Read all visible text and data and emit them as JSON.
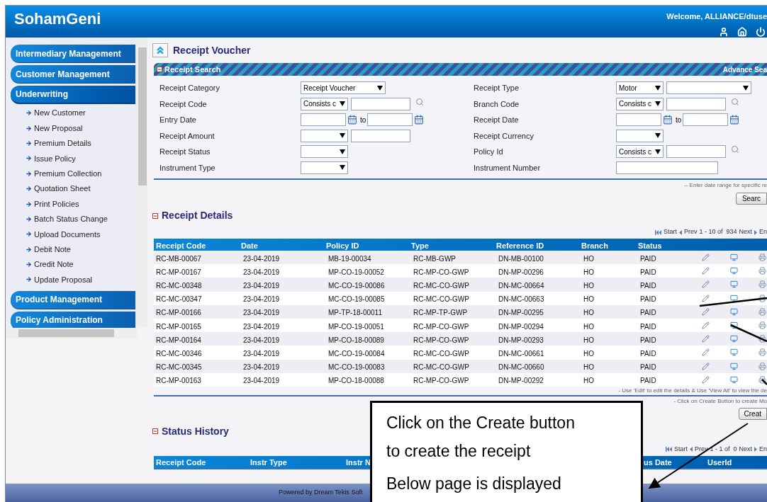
{
  "header": {
    "app_title": "SohamGeni",
    "welcome": "Welcome, ALLIANCE/dtuse"
  },
  "sidebar": {
    "sections": [
      {
        "label": "Intermediary Management",
        "expanded": false
      },
      {
        "label": "Customer Management",
        "expanded": false
      },
      {
        "label": "Underwriting",
        "expanded": true,
        "items": [
          "New Customer",
          "New Proposal",
          "Premium Details",
          "Issue Policy",
          "Premium Collection",
          "Quotation Sheet",
          "Print Policies",
          "Batch Status Change",
          "Upload Documents",
          "Debit Note",
          "Credit Note",
          "Update Proposal"
        ]
      },
      {
        "label": "Product Management",
        "expanded": false
      },
      {
        "label": "Policy Administration",
        "expanded": false
      }
    ]
  },
  "page_title": "Receipt Voucher",
  "search": {
    "title": "Receipt Search",
    "advance_link": "Advance Sea",
    "left_fields": [
      {
        "label": "Receipt Category",
        "kind": "select_wide",
        "value": "Receipt Voucher"
      },
      {
        "label": "Receipt Code",
        "kind": "op_lookup",
        "value": "Consists c"
      },
      {
        "label": "Entry Date",
        "kind": "date_range",
        "separator": "to"
      },
      {
        "label": "Receipt Amount",
        "kind": "select_input"
      },
      {
        "label": "Receipt Status",
        "kind": "select"
      },
      {
        "label": "Instrument Type",
        "kind": "select"
      }
    ],
    "right_fields": [
      {
        "label": "Receipt Type",
        "kind": "select_pair",
        "value": "Motor"
      },
      {
        "label": "Branch Code",
        "kind": "op_lookup",
        "value": "Consists c"
      },
      {
        "label": "Receipt Date",
        "kind": "date_range",
        "separator": "to"
      },
      {
        "label": "Receipt Currency",
        "kind": "select"
      },
      {
        "label": "Policy Id",
        "kind": "op_lookup",
        "value": "Consists c"
      },
      {
        "label": "Instrument Number",
        "kind": "input"
      }
    ],
    "hint": "-- Enter date range for specific re",
    "search_button": "Searc"
  },
  "receipt_details": {
    "title": "Receipt Details",
    "pager": {
      "start": "Start",
      "prev": "Prev",
      "range": "1 - 10 of  934",
      "next": "Next",
      "end": "En"
    },
    "columns": [
      "Receipt Code",
      "Date",
      "Policy ID",
      "Type",
      "Reference ID",
      "Branch",
      "Status"
    ],
    "rows": [
      [
        "RC-MB-00067",
        "23-04-2019",
        "MB-19-00034",
        "RC-MB-GWP",
        "DN-MB-00100",
        "HO",
        "PAID"
      ],
      [
        "RC-MP-00167",
        "23-04-2019",
        "MP-CO-19-00052",
        "RC-MP-CO-GWP",
        "DN-MP-00296",
        "HO",
        "PAID"
      ],
      [
        "RC-MC-00348",
        "23-04-2019",
        "MC-CO-19-00086",
        "RC-MC-CO-GWP",
        "DN-MC-00664",
        "HO",
        "PAID"
      ],
      [
        "RC-MC-00347",
        "23-04-2019",
        "MC-CO-19-00085",
        "RC-MC-CO-GWP",
        "DN-MC-00663",
        "HO",
        "PAID"
      ],
      [
        "RC-MP-00166",
        "23-04-2019",
        "MP-TP-18-00011",
        "RC-MP-TP-GWP",
        "DN-MP-00295",
        "HO",
        "PAID"
      ],
      [
        "RC-MP-00165",
        "23-04-2019",
        "MP-CO-19-00051",
        "RC-MP-CO-GWP",
        "DN-MP-00294",
        "HO",
        "PAID"
      ],
      [
        "RC-MP-00164",
        "23-04-2019",
        "MP-CO-18-00089",
        "RC-MP-CO-GWP",
        "DN-MP-00293",
        "HO",
        "PAID"
      ],
      [
        "RC-MC-00346",
        "23-04-2019",
        "MC-CO-19-00084",
        "RC-MC-CO-GWP",
        "DN-MC-00661",
        "HO",
        "PAID"
      ],
      [
        "RC-MC-00345",
        "23-04-2019",
        "MC-CO-19-00083",
        "RC-MC-CO-GWP",
        "DN-MC-00660",
        "HO",
        "PAID"
      ],
      [
        "RC-MP-00163",
        "23-04-2019",
        "MP-CO-18-00088",
        "RC-MP-CO-GWP",
        "DN-MP-00292",
        "HO",
        "PAID"
      ]
    ],
    "notes": [
      "- Use 'Edit' to edit the details & Use 'View All' to view the de",
      "- Click on Create Button to create Mo"
    ],
    "create_button": "Creat"
  },
  "status_history": {
    "title": "Status History",
    "pager": {
      "start": "Start",
      "prev": "Prev",
      "range": "1 - 1 of  0",
      "next": "Next",
      "end": "En"
    },
    "columns": [
      "Receipt Code",
      "Instr Type",
      "Instr N",
      "us Date",
      "UserId"
    ]
  },
  "footer": "Powered by Dream Tekis Soft",
  "callout": {
    "lines": [
      "Click on the Create button",
      "to create the receipt",
      "Below page is displayed"
    ]
  }
}
